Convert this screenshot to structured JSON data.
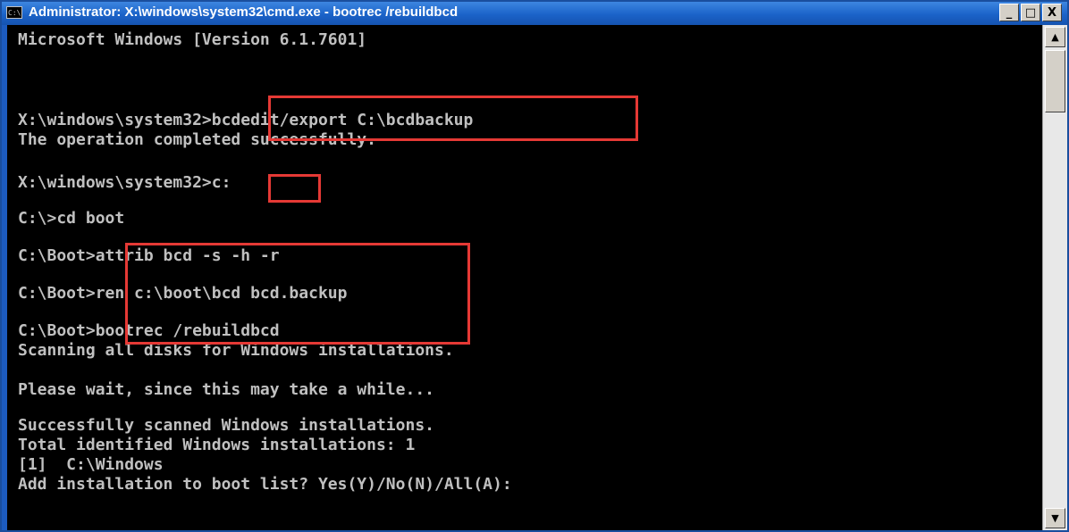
{
  "window": {
    "title": "Administrator: X:\\windows\\system32\\cmd.exe - bootrec  /rebuildbcd",
    "icon_label": "C:\\",
    "minimize": "_",
    "maximize": "□",
    "close": "X"
  },
  "console": {
    "lines": [
      "Microsoft Windows [Version 6.1.7601]",
      "X:\\windows\\system32>bcdedit/export C:\\bcdbackup",
      "The operation completed successfully.",
      "X:\\windows\\system32>c:",
      "C:\\>cd boot",
      "C:\\Boot>attrib bcd -s -h -r",
      "C:\\Boot>ren c:\\boot\\bcd bcd.backup",
      "C:\\Boot>bootrec /rebuildbcd",
      "Scanning all disks for Windows installations.",
      "Please wait, since this may take a while...",
      "Successfully scanned Windows installations.",
      "Total identified Windows installations: 1",
      "[1]  C:\\Windows",
      "Add installation to boot list? Yes(Y)/No(N)/All(A):"
    ]
  },
  "colors": {
    "title_bar": "#1b63c9",
    "console_bg": "#000000",
    "console_text": "#c0c0c0",
    "highlight": "#e53935"
  },
  "scrollbar": {
    "up_arrow": "▲",
    "down_arrow": "▼"
  }
}
